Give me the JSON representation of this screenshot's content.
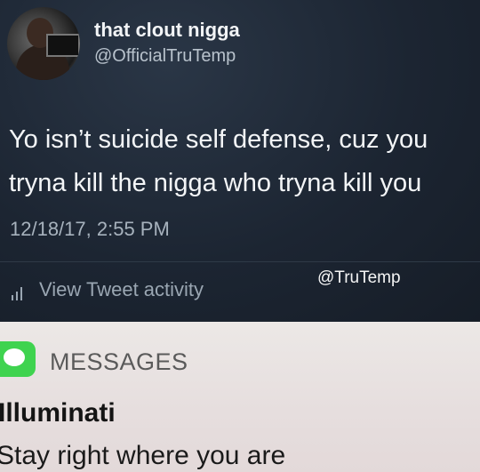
{
  "tweet": {
    "display_name": "that clout nigga",
    "handle": "@OfficialTruTemp",
    "text_line1": "Yo isn’t suicide self defense, cuz you",
    "text_line2": "tryna kill the nigga who tryna kill you",
    "timestamp": "12/18/17, 2:55 PM",
    "activity_label": "View Tweet activity",
    "activity_icon": "bar-chart-icon",
    "watermark": "@TruTemp"
  },
  "notification": {
    "app_icon": "messages-icon",
    "app_icon_color": "#3fd34f",
    "app_name": "MESSAGES",
    "sender": "Illuminati",
    "message": "Stay right where you are"
  }
}
